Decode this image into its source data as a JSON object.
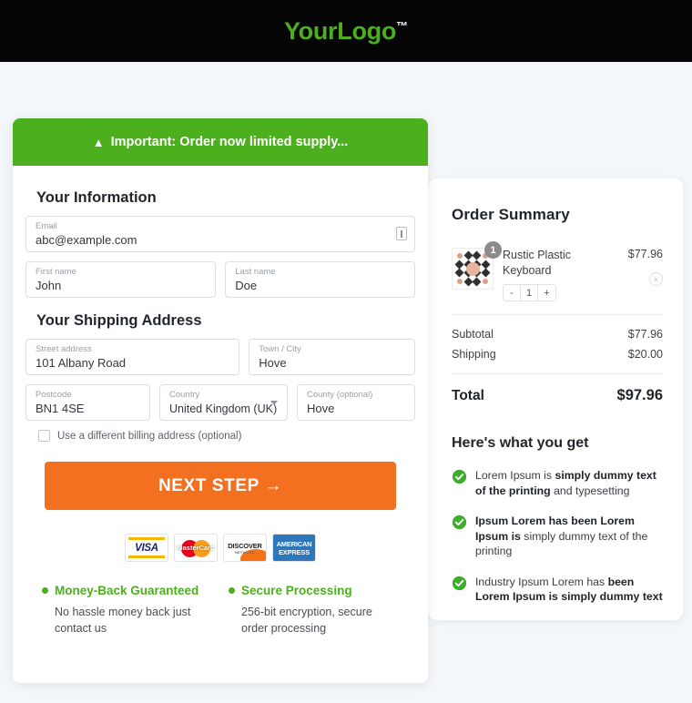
{
  "header": {
    "logo_text": "YourLogo",
    "logo_tm": "™",
    "logo_color": "#4caf1e",
    "bar_color": "#050505"
  },
  "alert": {
    "icon": "warning-triangle-icon",
    "glyph": "▲",
    "text": "Important: Order now limited supply...",
    "color": "#4caf1e"
  },
  "form": {
    "information_title": "Your Information",
    "shipping_title": "Your Shipping Address",
    "fields": {
      "email": {
        "label": "Email",
        "value": "abc@example.com"
      },
      "first": {
        "label": "First name",
        "value": "John"
      },
      "last": {
        "label": "Last name",
        "value": "Doe"
      },
      "street": {
        "label": "Street address",
        "value": "101 Albany Road"
      },
      "town": {
        "label": "Town / City",
        "value": "Hove"
      },
      "postcode": {
        "label": "Postcode",
        "value": "BN1 4SE"
      },
      "country": {
        "label": "Country",
        "value": "United Kingdom (UK)"
      },
      "county": {
        "label": "County (optional)",
        "value": "Hove"
      }
    },
    "billing_checkbox": {
      "label": "Use a different billing address (optional)",
      "checked": false
    },
    "next_button": {
      "label": "NEXT STEP →",
      "color": "#f37021"
    },
    "payment_cards": [
      {
        "name": "visa",
        "label": "VISA"
      },
      {
        "name": "mastercard",
        "label": "MasterCard"
      },
      {
        "name": "discover",
        "label": "DISCOVER",
        "sub": "NETWORK"
      },
      {
        "name": "amex",
        "label_line1": "AMERICAN",
        "label_line2": "EXPRESS"
      }
    ],
    "trust": [
      {
        "title": "Money-Back Guaranteed",
        "body": "No hassle money back just contact us"
      },
      {
        "title": "Secure Processing",
        "body": "256-bit encryption, secure order processing"
      }
    ]
  },
  "summary": {
    "title": "Order Summary",
    "item": {
      "name": "Rustic Plastic Keyboard",
      "price": "$77.96",
      "badge_qty": "1",
      "qty": "1",
      "decrement": "-",
      "increment": "+",
      "remove_glyph": "×"
    },
    "rows": [
      {
        "label": "Subtotal",
        "value": "$77.96"
      },
      {
        "label": "Shipping",
        "value": "$20.00"
      }
    ],
    "total": {
      "label": "Total",
      "value": "$97.96"
    },
    "benefits_title": "Here's what you get",
    "benefits": [
      {
        "parts": [
          {
            "t": "Lorem Ipsum is ",
            "b": false
          },
          {
            "t": "simply dummy text of the printing",
            "b": true
          },
          {
            "t": " and typesetting",
            "b": false
          }
        ]
      },
      {
        "parts": [
          {
            "t": "Ipsum Lorem has been Lorem Ipsum is",
            "b": true
          },
          {
            "t": " simply dummy text of the printing",
            "b": false
          }
        ]
      },
      {
        "parts": [
          {
            "t": "Industry Ipsum Lorem has ",
            "b": false
          },
          {
            "t": "been Lorem Ipsum is simply dummy text",
            "b": true
          }
        ]
      }
    ],
    "check_color": "#3dae2b"
  }
}
